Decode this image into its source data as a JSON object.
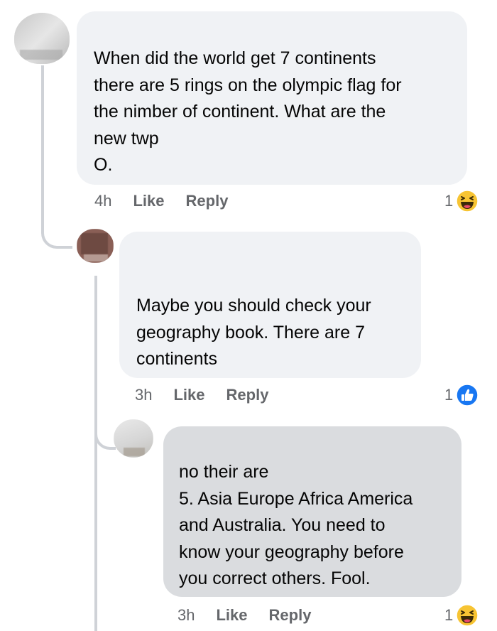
{
  "comments": [
    {
      "text": "When did the world get 7 continents\nthere are 5 rings on the olympic flag for\nthe nimber of continent. What are the\nnew twp\nO.",
      "time": "4h",
      "like_label": "Like",
      "reply_label": "Reply",
      "reaction_count": "1",
      "reaction_icon": "haha-emoji-icon"
    },
    {
      "text": "Maybe you should check your\ngeography book. There are 7\ncontinents",
      "time": "3h",
      "like_label": "Like",
      "reply_label": "Reply",
      "reaction_count": "1",
      "reaction_icon": "like-thumb-icon"
    },
    {
      "text": "no their are\n5. Asia Europe Africa America\nand Australia. You need to\nknow your geography before\nyou correct others. Fool.",
      "time": "3h",
      "like_label": "Like",
      "reply_label": "Reply",
      "reaction_count": "1",
      "reaction_icon": "haha-emoji-icon"
    }
  ],
  "colors": {
    "bubble": "#f0f2f5",
    "bubble_highlight": "#dadcdf",
    "meta_text": "#65676b",
    "like_blue": "#1877f2",
    "haha_yellow": "#f7c433"
  }
}
